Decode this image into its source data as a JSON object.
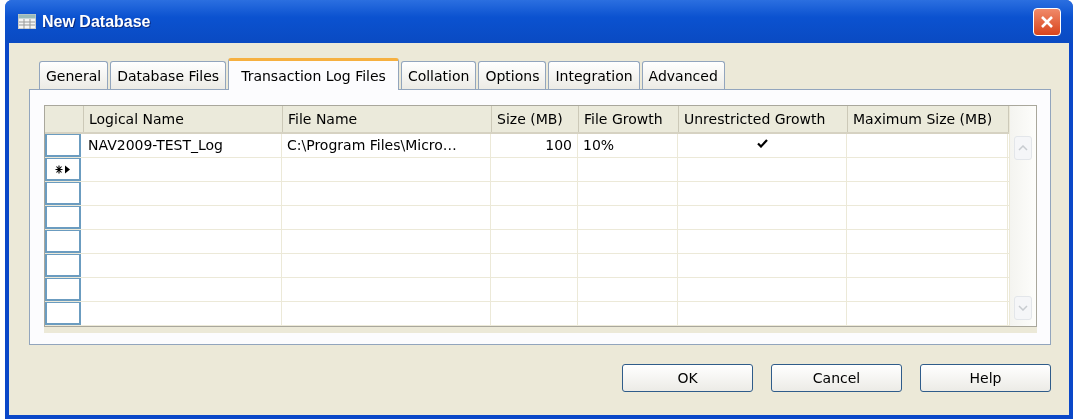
{
  "window": {
    "title": "New Database"
  },
  "tabs": [
    {
      "label": "General",
      "selected": false
    },
    {
      "label": "Database Files",
      "selected": false
    },
    {
      "label": "Transaction Log Files",
      "selected": true
    },
    {
      "label": "Collation",
      "selected": false
    },
    {
      "label": "Options",
      "selected": false
    },
    {
      "label": "Integration",
      "selected": false
    },
    {
      "label": "Advanced",
      "selected": false
    }
  ],
  "grid": {
    "columns": [
      "Logical Name",
      "File Name",
      "Size (MB)",
      "File Growth",
      "Unrestricted Growth",
      "Maximum Size (MB)"
    ],
    "rows": [
      {
        "kind": "data",
        "logical_name": "NAV2009-TEST_Log",
        "file_name": "C:\\Program Files\\Micro…",
        "size": "100",
        "file_growth": "10%",
        "unrestricted_growth": true
      },
      {
        "kind": "new"
      }
    ]
  },
  "buttons": [
    "OK",
    "Cancel",
    "Help"
  ]
}
